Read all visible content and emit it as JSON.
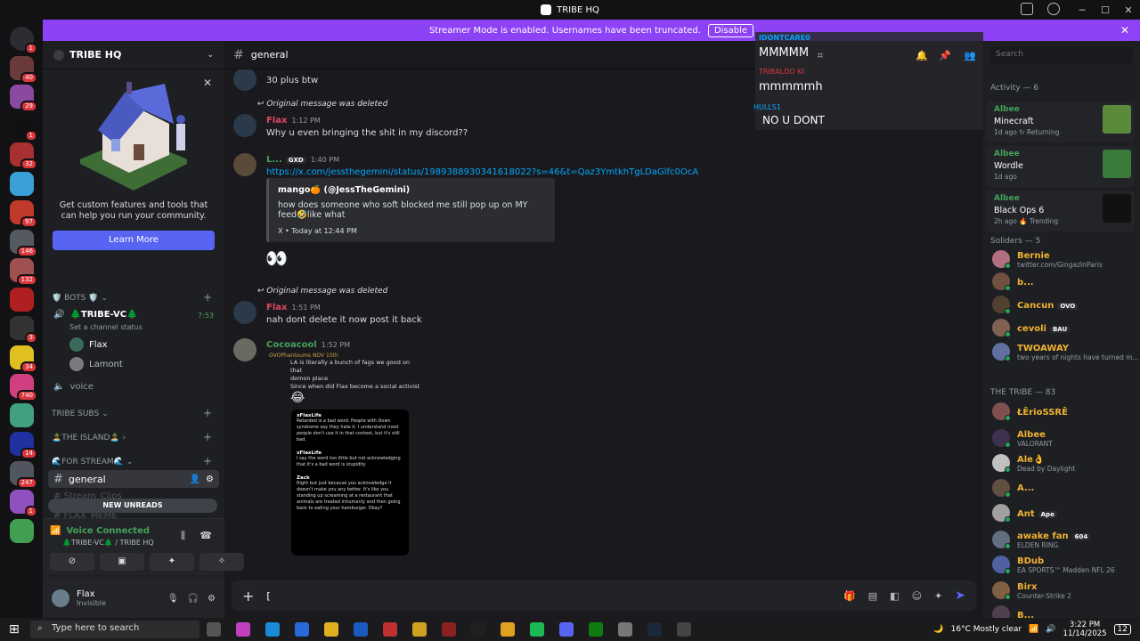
{
  "window": {
    "title": "TRIBE HQ"
  },
  "banner": {
    "text": "Streamer Mode is enabled. Usernames have been truncated.",
    "button": "Disable"
  },
  "guilds": [
    {
      "color": "#2b2d31",
      "badge": "1",
      "icon": "discord-home-icon"
    },
    {
      "color": "#6b3a3a",
      "badge": "40"
    },
    {
      "color": "#8a4aa0",
      "badge": "29"
    },
    {
      "color": "#111111",
      "badge": "1"
    },
    {
      "color": "#a73030",
      "badge": "32"
    },
    {
      "color": "#3aa0d8",
      "badge": ""
    },
    {
      "color": "#c0392b",
      "badge": "97"
    },
    {
      "color": "#555a60",
      "badge": "146"
    },
    {
      "color": "#a05050",
      "badge": "132"
    },
    {
      "color": "#b02020",
      "badge": ""
    },
    {
      "color": "#333333",
      "badge": "3"
    },
    {
      "color": "#e0c020",
      "badge": "34"
    },
    {
      "color": "#d04080",
      "badge": "740"
    },
    {
      "color": "#40a080",
      "badge": ""
    },
    {
      "color": "#2030a0",
      "badge": "14"
    },
    {
      "color": "#505560",
      "badge": "247"
    },
    {
      "color": "#9050c0",
      "badge": "1"
    },
    {
      "color": "#40a050",
      "badge": ""
    }
  ],
  "sidebar": {
    "server_name": "TRIBE HQ",
    "promo_text": "Get custom features and tools that can help you run your community.",
    "promo_button": "Learn More",
    "cat_bots": "🛡️ BOTS 🛡️",
    "voice_channel": "🌲TRIBE-VC🌲",
    "voice_time": "7:53",
    "channel_status": "Set a channel status",
    "voice_user1": "Flax",
    "voice_user2": "Lamont",
    "voice": "voice",
    "cat_subs": "TRIBE SUBS",
    "cat_island": "🏝️THE ISLAND🏝️",
    "cat_stream": "🌊FOR STREAM🌊",
    "selected_channel": "general",
    "hidden_channel1": "Stream_Clips",
    "hidden_channel2": "FLAX_MEME",
    "new_unreads": "NEW UNREADS",
    "voice_connected": "Voice Connected",
    "voice_sub": "🌲TRIBE-VC🌲 / TRIBE HQ",
    "user_name": "Flax",
    "user_status": "Invisible"
  },
  "chat": {
    "channel": "general",
    "m0_text": "30 plus btw",
    "deleted": "Original message was deleted",
    "m1_user": "Flax",
    "m1_time": "1:12 PM",
    "m1_text": "Why u even bringing the shit in my discord??",
    "m2_user": "L...",
    "m2_tag": "GXD",
    "m2_time": "1:40 PM",
    "m2_link": "https://x.com/jessthegemini/status/1989388930341618022?s=46&t=Qaz3YmtkhTgLDaGlfc0OcA",
    "embed_author": "mango🍊 (@JessTheGemini)",
    "embed_text": "how does someone who soft blocked me still pop up on MY feed🤣like what",
    "embed_footer": "X • Today at 12:44 PM",
    "eyes": "👀",
    "m3_user": "Flax",
    "m3_time": "1:51 PM",
    "m3_text": "nah dont delete it now post it back",
    "m4_user": "Cocoacool",
    "m4_time": "1:52 PM",
    "q_user": "OVOPhantoums NOV 15th",
    "q_line1": "LA is literally a bunch of fags we good on that",
    "q_line2": "demon place",
    "q_line3": "Since when did Flax become a social activist",
    "tw1_user": "xFlaxLife",
    "tw1_text": "Retarded is a bad word. People with Down syndrome say they hate it. I understand most people don't use it in that context, but it's still bad.",
    "tw2_user": "xFlaxLife",
    "tw2_text": "I say the word too little but not acknowledging that it's a bad word is stupidity",
    "tw3_user": "Zack",
    "tw3_text": "Right but just because you acknowledge it doesn't make you any better. It's like you standing up screaming at a restaurant that animals are treated inhumanly and then going back to eating your hamburger. Okay?"
  },
  "input": {
    "placeholder": "["
  },
  "overlay": {
    "l1": "IDONTCARE0",
    "t1": "MMMMM",
    "l2": "TRIBALDO KI",
    "t2": "mmmmmh",
    "l3": "HULLS1",
    "t3": "NO U DONT"
  },
  "members": {
    "search": "Search",
    "activity_header": "Activity — 6",
    "acts": [
      {
        "who": "Albee",
        "game": "Minecraft",
        "ago": "1d ago  ↻ Returning",
        "color": "#5a8a3a"
      },
      {
        "who": "Albee",
        "game": "Wordle",
        "ago": "1d ago",
        "color": "#3a7a3a"
      },
      {
        "who": "Albee",
        "game": "Black Ops 6",
        "ago": "2h ago  🔥 Trending",
        "color": "#111111"
      }
    ],
    "soliders_header": "Soliders — 5",
    "soliders": [
      {
        "name": "Bernie",
        "status": "twitter.com/GingazInParis",
        "tag": "",
        "color": "#b07080"
      },
      {
        "name": "b...",
        "status": "",
        "tag": "",
        "color": "#705040"
      },
      {
        "name": "Cancun",
        "status": "",
        "tag": "OVO",
        "color": "#504030"
      },
      {
        "name": "cevoli",
        "status": "",
        "tag": "BAU",
        "color": "#806050"
      },
      {
        "name": "TWOAWAY",
        "status": "two years of nights have turned m...",
        "tag": "",
        "color": "#6070a0"
      }
    ],
    "tribe_header": "THE TRIBE — 83",
    "tribe": [
      {
        "name": "ŁĒrioSSRĒ",
        "status": "",
        "tag": "",
        "color": "#805050"
      },
      {
        "name": "Albee",
        "status": "VALORANT",
        "tag": "",
        "color": "#403050"
      },
      {
        "name": "Ale👌",
        "status": "Dead by Daylight",
        "tag": "",
        "color": "#c0c0c0"
      },
      {
        "name": "A...",
        "status": "",
        "tag": "",
        "color": "#605040"
      },
      {
        "name": "Ant",
        "status": "",
        "tag": "Ape",
        "color": "#a0a0a0"
      },
      {
        "name": "awake fan",
        "status": "ELDEN RING",
        "tag": "604",
        "color": "#607080"
      },
      {
        "name": "BDub",
        "status": "EA SPORTS™ Madden NFL 26",
        "tag": "",
        "color": "#5060a0"
      },
      {
        "name": "Birx",
        "status": "Counter-Strike 2",
        "tag": "",
        "color": "#806040"
      },
      {
        "name": "B...",
        "status": "",
        "tag": "",
        "color": "#504050"
      }
    ]
  },
  "taskbar": {
    "search": "Type here to search",
    "weather": "16°C  Mostly clear",
    "time": "3:22 PM",
    "date": "11/14/2025",
    "notif": "12"
  }
}
